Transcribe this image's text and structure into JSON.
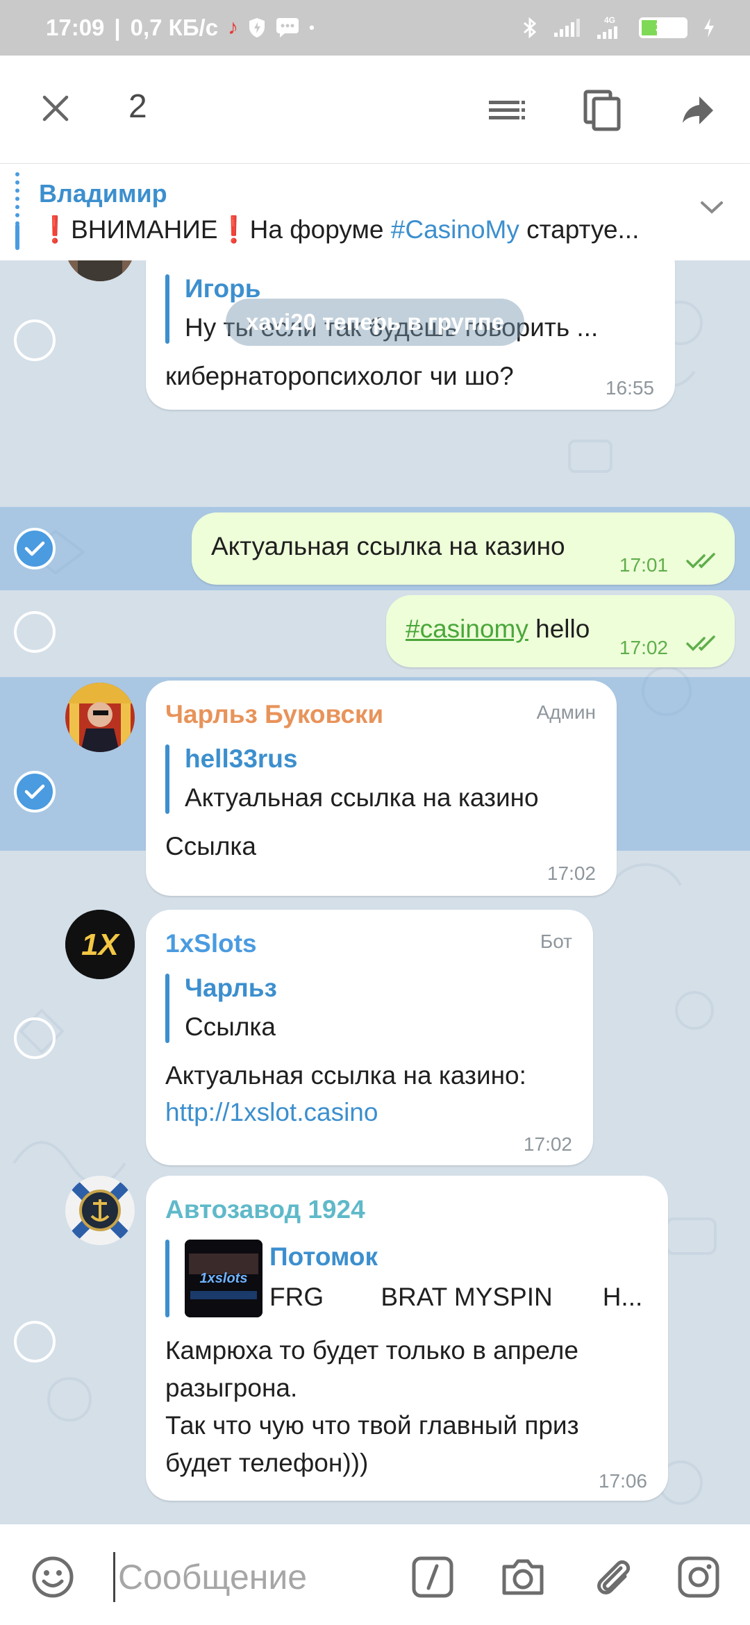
{
  "status_bar": {
    "time": "17:09",
    "speed": "0,7 КБ/с",
    "network": "4G",
    "battery": "35",
    "battery_level_percent": 35
  },
  "action_bar": {
    "selected_count": "2",
    "icons": [
      "close-icon",
      "select-text-icon",
      "copy-icon",
      "forward-icon"
    ]
  },
  "pinned": {
    "author": "Владимир",
    "text_prefix": "❗ВНИМАНИЕ❗На форуме ",
    "text_hashtag": "#CasinoMy",
    "text_suffix": " стартуе..."
  },
  "messages": {
    "m1": {
      "reply_author": "Игорь",
      "reply_text": "Ну ты если так будешь говорить ...",
      "text": "кибернаторопсихолог чи шо?",
      "time": "16:55"
    },
    "service": "xavi20 теперь в группе",
    "m2": {
      "text": "Актуальная ссылка на казино",
      "time": "17:01"
    },
    "m3": {
      "hashtag": "#casinomy",
      "text": " hello",
      "time": "17:02"
    },
    "m4": {
      "sender": "Чарльз Буковски",
      "role": "Админ",
      "reply_author": "hell33rus",
      "reply_text": "Актуальная ссылка на казино",
      "text": "Ссылка",
      "time": "17:02"
    },
    "m5": {
      "sender": "1xSlots",
      "role": "Бот",
      "reply_author": "Чарльз",
      "reply_text": "Ссылка",
      "text": "Актуальная ссылка на казино:",
      "link": "http://1xslot.casino",
      "time": "17:02"
    },
    "m6": {
      "sender": "Автозавод 1924",
      "reply_author": "Потомок",
      "reply_text": "FRG        BRAT MYSPIN       H...",
      "thumb_text": "1xslots",
      "text_line1": "Камрюха то будет только в апреле",
      "text_line2": "разыгрона.",
      "text_line3": "Так что чую что твой главный приз",
      "text_line4": "будет телефон)))",
      "time": "17:06"
    }
  },
  "input": {
    "placeholder": "Сообщение"
  },
  "colors": {
    "accent": "#3c8fce",
    "admin_name": "#e8935a",
    "bot_name": "#4a9be0",
    "group_name": "#5fb9c9",
    "outgoing_bubble": "#eefed9",
    "selection": "#a6c7e6"
  }
}
